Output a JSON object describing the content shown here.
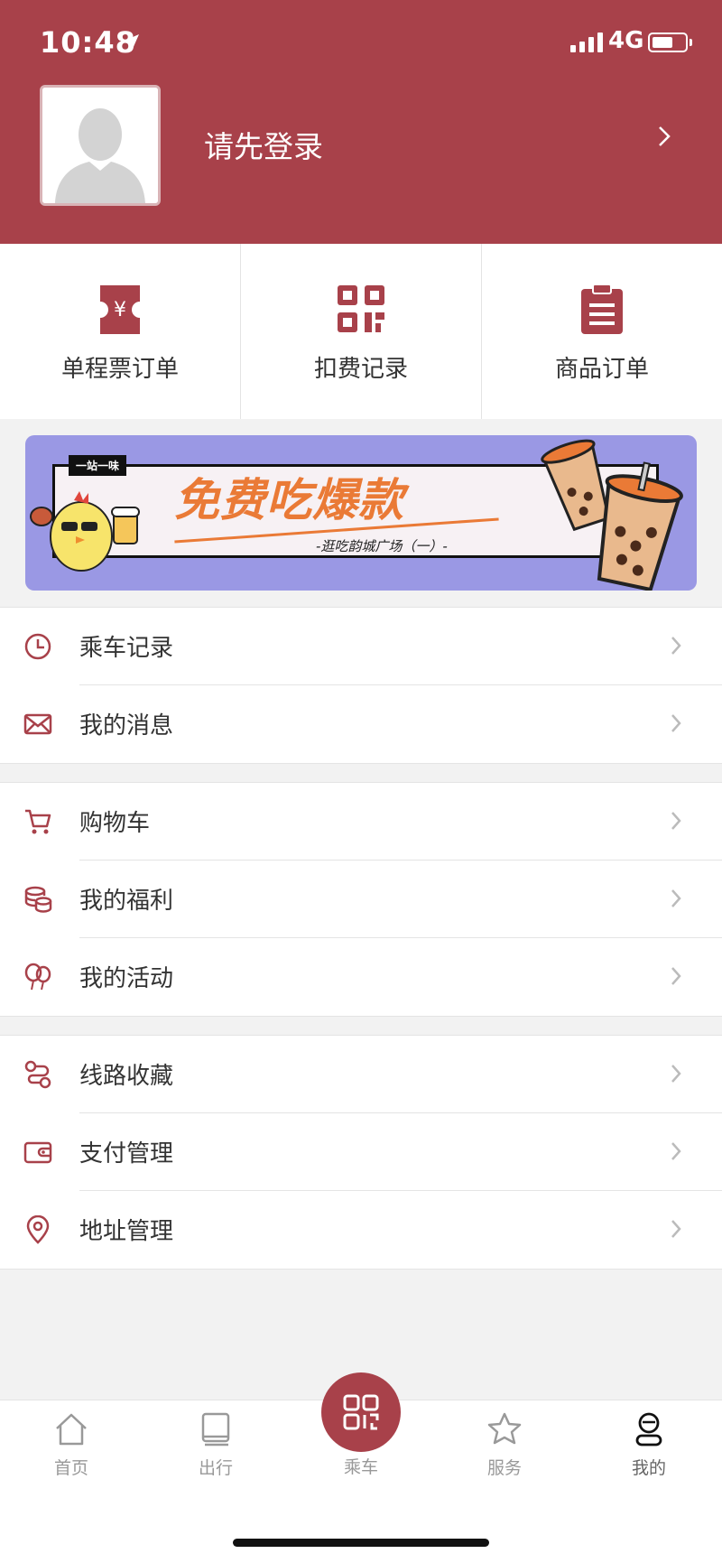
{
  "status_bar": {
    "time": "10:48",
    "network": "4G"
  },
  "profile": {
    "login_prompt": "请先登录"
  },
  "quick_actions": [
    {
      "label": "单程票订单",
      "icon": "ticket-yen-icon"
    },
    {
      "label": "扣费记录",
      "icon": "qr-code-icon"
    },
    {
      "label": "商品订单",
      "icon": "clipboard-list-icon"
    }
  ],
  "banner": {
    "tag": "一站一味",
    "title": "免费吃爆款",
    "subtitle": "-逛吃韵城广场（一）-"
  },
  "menu_groups": [
    [
      {
        "label": "乘车记录",
        "icon": "clock-icon"
      },
      {
        "label": "我的消息",
        "icon": "mail-icon"
      }
    ],
    [
      {
        "label": "购物车",
        "icon": "cart-icon"
      },
      {
        "label": "我的福利",
        "icon": "coins-icon"
      },
      {
        "label": "我的活动",
        "icon": "balloon-icon"
      }
    ],
    [
      {
        "label": "线路收藏",
        "icon": "route-icon"
      },
      {
        "label": "支付管理",
        "icon": "wallet-icon"
      },
      {
        "label": "地址管理",
        "icon": "location-pin-icon"
      }
    ]
  ],
  "tabbar": {
    "items": [
      {
        "label": "首页",
        "icon": "home-icon"
      },
      {
        "label": "出行",
        "icon": "book-icon"
      },
      {
        "label": "乘车",
        "icon": "qr-code-icon"
      },
      {
        "label": "服务",
        "icon": "star-icon"
      },
      {
        "label": "我的",
        "icon": "user-icon"
      }
    ],
    "active": "我的"
  },
  "colors": {
    "brand": "#a8414a",
    "banner_bg": "#9a98e4",
    "banner_title": "#ea7a36"
  }
}
